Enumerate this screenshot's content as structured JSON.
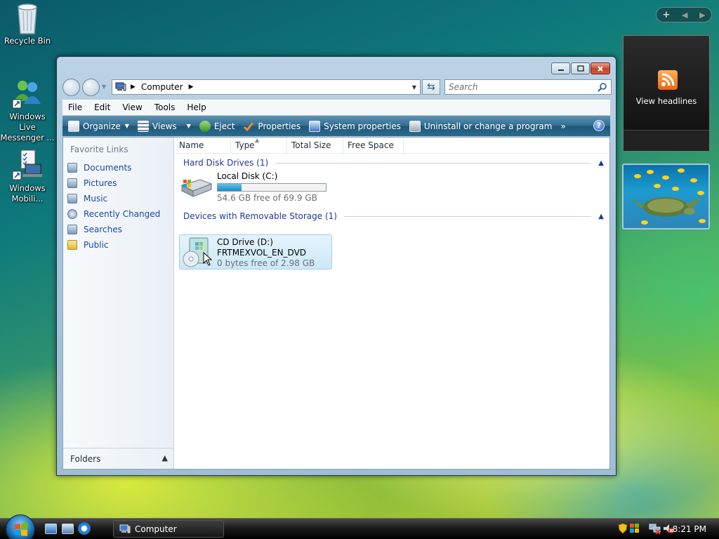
{
  "desktop": {
    "icons": [
      {
        "label": "Recycle Bin"
      },
      {
        "label": "Windows Live Messenger ..."
      },
      {
        "label": "Windows Mobili..."
      }
    ]
  },
  "window": {
    "address": {
      "location": "Computer"
    },
    "search": {
      "placeholder": "Search"
    },
    "menu": [
      "File",
      "Edit",
      "View",
      "Tools",
      "Help"
    ],
    "toolbar": {
      "organize": "Organize",
      "views": "Views",
      "eject": "Eject",
      "properties": "Properties",
      "system_properties": "System properties",
      "uninstall": "Uninstall or change a program",
      "more": "»"
    },
    "nav": {
      "favorite_links_title": "Favorite Links",
      "links": [
        "Documents",
        "Pictures",
        "Music",
        "Recently Changed",
        "Searches",
        "Public"
      ],
      "folders_label": "Folders"
    },
    "columns": [
      "Name",
      "Type",
      "Total Size",
      "Free Space"
    ],
    "groups": [
      {
        "title": "Hard Disk Drives (1)",
        "items": [
          {
            "name": "Local Disk (C:)",
            "detail": "54.6 GB free of 69.9 GB",
            "used_fraction": 0.219
          }
        ]
      },
      {
        "title": "Devices with Removable Storage (1)",
        "items": [
          {
            "name": "CD Drive (D:)",
            "label": "FRTMEXVOL_EN_DVD",
            "detail": "0 bytes free of 2.98 GB"
          }
        ]
      }
    ]
  },
  "sidebar": {
    "feed_label": "View headlines"
  },
  "taskbar": {
    "active_task": "Computer",
    "clock": "8:21 PM"
  },
  "colors": {
    "toolbar_blue": "#2f6b8f",
    "link_blue": "#1c48a0",
    "group_header": "#1e3a8f"
  }
}
